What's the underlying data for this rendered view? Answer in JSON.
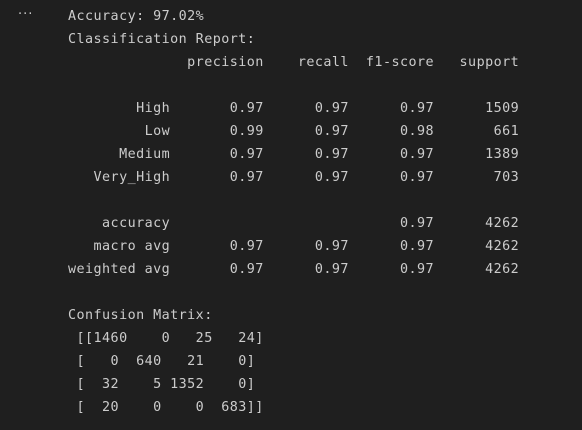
{
  "toolbar": {
    "more_actions_label": "···"
  },
  "output": {
    "lines": [
      "Accuracy: 97.02%",
      "Classification Report:",
      "              precision    recall  f1-score   support",
      "",
      "        High       0.97      0.97      0.97      1509",
      "         Low       0.99      0.97      0.98       661",
      "      Medium       0.97      0.97      0.97      1389",
      "   Very_High       0.97      0.97      0.97       703",
      "",
      "    accuracy                           0.97      4262",
      "   macro avg       0.97      0.97      0.97      4262",
      "weighted avg       0.97      0.97      0.97      4262",
      "",
      "Confusion Matrix:",
      " [[1460    0   25   24]",
      " [   0  640   21    0]",
      " [  32    5 1352    0]",
      " [  20    0    0  683]]"
    ]
  }
}
